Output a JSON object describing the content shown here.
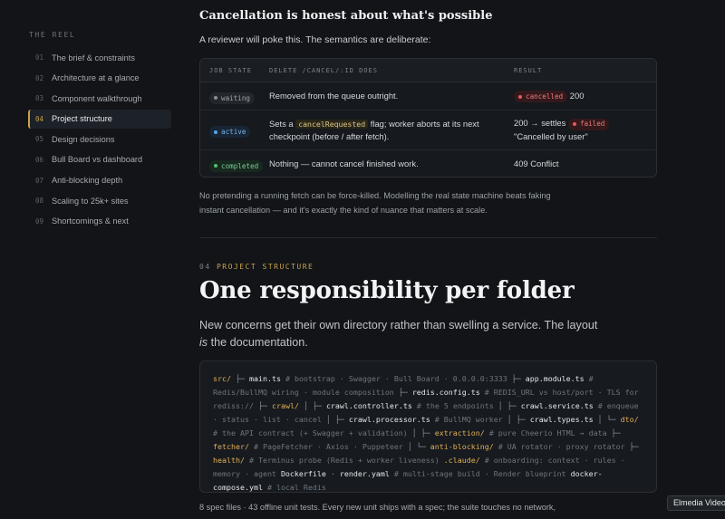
{
  "sidebar": {
    "title": "THE REEL",
    "items": [
      {
        "num": "01",
        "label": "The brief & constraints"
      },
      {
        "num": "02",
        "label": "Architecture at a glance"
      },
      {
        "num": "03",
        "label": "Component walkthrough"
      },
      {
        "num": "04",
        "label": "Project structure",
        "active": true
      },
      {
        "num": "05",
        "label": "Design decisions"
      },
      {
        "num": "06",
        "label": "Bull Board vs dashboard"
      },
      {
        "num": "07",
        "label": "Anti-blocking depth"
      },
      {
        "num": "08",
        "label": "Scaling to 25k+ sites"
      },
      {
        "num": "09",
        "label": "Shortcomings & next"
      }
    ]
  },
  "cancel_section": {
    "heading": "Cancellation is honest about what's possible",
    "intro": "A reviewer will poke this. The semantics are deliberate:",
    "table": {
      "headers": [
        "JOB STATE",
        "DELETE /CANCEL/:ID DOES",
        "RESULT"
      ],
      "rows": [
        {
          "state": "waiting",
          "does": "Removed from the queue outright.",
          "result_badge": "cancelled",
          "result_text": "200"
        },
        {
          "state": "active",
          "does_pre": "Sets a",
          "does_code": "cancelRequested",
          "does_post": "flag; worker aborts at its next checkpoint (before / after fetch).",
          "result_pre": "200 → settles",
          "result_badge": "failed",
          "result_text": "\"Cancelled by user\""
        },
        {
          "state": "completed",
          "does": "Nothing — cannot cancel finished work.",
          "result_text": "409 Conflict"
        }
      ]
    },
    "note": "No pretending a running fetch can be force-killed. Modelling the real state machine beats faking instant cancellation — and it's exactly the kind of nuance that matters at scale."
  },
  "structure_section": {
    "num": "04",
    "label": "PROJECT STRUCTURE",
    "heading": "One responsibility per folder",
    "lead_pre": "New concerns get their own directory rather than swelling a service. The layout",
    "lead_em": "is",
    "lead_post": "the documentation.",
    "code": {
      "src": "src/",
      "main_ts": "main.ts",
      "c_main": "# bootstrap · Swagger · Bull Board · 0.0.0.0:3333",
      "app_module": "app.module.ts",
      "c_app": "# Redis/BullMQ wiring · module composition",
      "redis_config": "redis.config.ts",
      "c_redis": "# REDIS_URL vs host/port · TLS for rediss://",
      "crawl": "crawl/",
      "crawl_controller": "crawl.controller.ts",
      "c_controller": "# the 5 endpoints",
      "crawl_service": "crawl.service.ts",
      "c_service": "# enqueue · status · list · cancel",
      "crawl_processor": "crawl.processor.ts",
      "c_processor": "# BullMQ worker",
      "crawl_types": "crawl.types.ts",
      "dto": "dto/",
      "c_dto": "# the API contract (+ Swagger + validation)",
      "extraction": "extraction/",
      "c_extraction": "# pure Cheerio HTML → data",
      "fetcher": "fetcher/",
      "c_fetcher": "# PageFetcher · Axios · Puppeteer",
      "anti_blocking": "anti-blocking/",
      "c_anti": "# UA rotator · proxy rotator",
      "health": "health/",
      "c_health": "# Terminus probe (Redis + worker liveness)",
      "claude": ".claude/",
      "c_claude": "# onboarding: context · rules · memory · agent",
      "dockerfile": "Dockerfile",
      "render_yaml": "render.yaml",
      "c_render": "# multi-stage build · Render blueprint",
      "compose": "docker-compose.yml",
      "c_compose": "# local Redis"
    },
    "footer": "8 spec files · 43 offline unit tests. Every new unit ships with a spec; the suite touches no network,"
  },
  "tooltip": "Elmedia Video"
}
